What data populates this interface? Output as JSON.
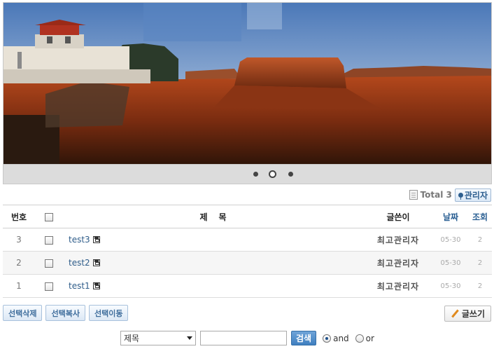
{
  "slider": {
    "dots": 3,
    "active_index": 1
  },
  "header": {
    "total_label": "Total 3",
    "admin_label": "관리자"
  },
  "columns": {
    "num": "번호",
    "subject": "제목",
    "author": "글쓴이",
    "date": "날짜",
    "views": "조회"
  },
  "rows": [
    {
      "num": "3",
      "title": "test3",
      "author": "최고관리자",
      "date": "05-30",
      "views": "2"
    },
    {
      "num": "2",
      "title": "test2",
      "author": "최고관리자",
      "date": "05-30",
      "views": "2"
    },
    {
      "num": "1",
      "title": "test1",
      "author": "최고관리자",
      "date": "05-30",
      "views": "2"
    }
  ],
  "actions": {
    "delete": "선택삭제",
    "copy": "선택복사",
    "move": "선택이동",
    "write": "글쓰기"
  },
  "search": {
    "field_selected": "제목",
    "query": "",
    "button": "검색",
    "and_label": "and",
    "or_label": "or",
    "mode": "and"
  },
  "icons": {
    "total": "document-icon",
    "admin": "pin-icon",
    "attachment": "disk-icon",
    "write": "pencil-icon"
  }
}
